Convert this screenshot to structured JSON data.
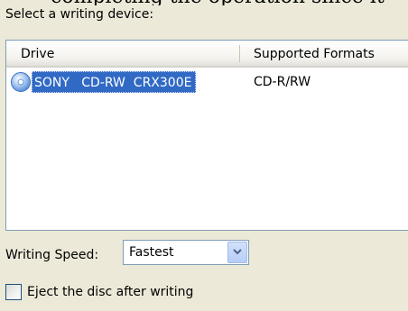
{
  "prompt": "Select a writing device:",
  "columns": {
    "drive": "Drive",
    "formats": "Supported Formats"
  },
  "devices": [
    {
      "drive": "SONY   CD-RW  CRX300E",
      "formats": "CD-R/RW",
      "icon": "cd-drive-icon",
      "selected": true
    }
  ],
  "speed": {
    "label": "Writing Speed:",
    "value": "Fastest",
    "icon": "chevron-down-icon"
  },
  "eject": {
    "label": "Eject the disc after writing",
    "checked": false
  },
  "colors": {
    "selection": "#316ac5",
    "dialog_bg": "#ece9d8",
    "border": "#7f9db9"
  }
}
